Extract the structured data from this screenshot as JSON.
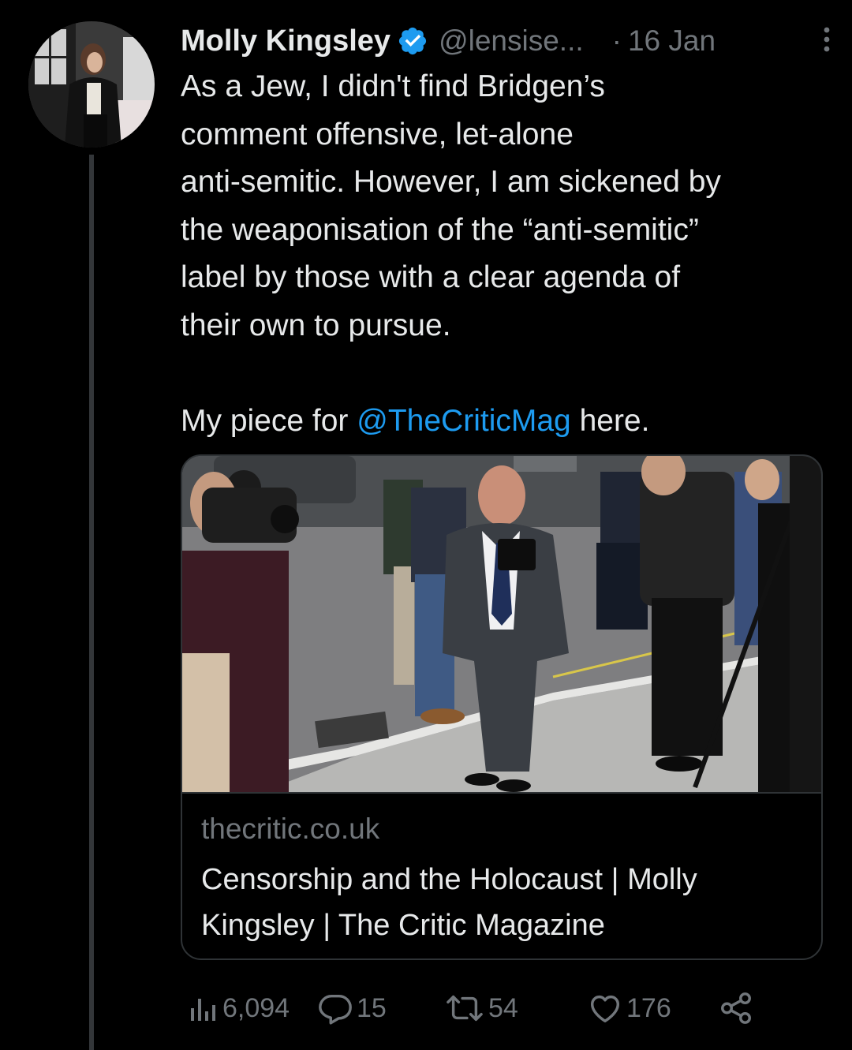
{
  "tweet": {
    "author_name": "Molly Kingsley",
    "handle": "@lensise...",
    "separator": "·",
    "date": "16 Jan",
    "text_lines": [
      "As a Jew, I didn't find Bridgen’s",
      "comment offensive, let-alone",
      "anti-semitic.  However, I am sickened by",
      "the weaponisation of the “anti-semitic”",
      "label by those with a clear agenda of",
      "their own to pursue."
    ],
    "second_paragraph": {
      "prefix": "My piece for ",
      "mention": "@TheCriticMag",
      "suffix": " here."
    }
  },
  "link_card": {
    "domain": "thecritic.co.uk",
    "title_lines": [
      "Censorship and the Holocaust | Molly",
      "Kingsley | The Critic Magazine"
    ]
  },
  "actions": {
    "views": "6,094",
    "replies": "15",
    "retweets": "54",
    "likes": "176"
  },
  "colors": {
    "background": "#000000",
    "text": "#e7e9ea",
    "secondary": "#71767b",
    "accent": "#1d9bf0",
    "border": "#2f3336"
  },
  "icons": [
    "verified-badge-icon",
    "more-options-icon",
    "views-icon",
    "reply-icon",
    "retweet-icon",
    "like-icon",
    "share-icon"
  ]
}
